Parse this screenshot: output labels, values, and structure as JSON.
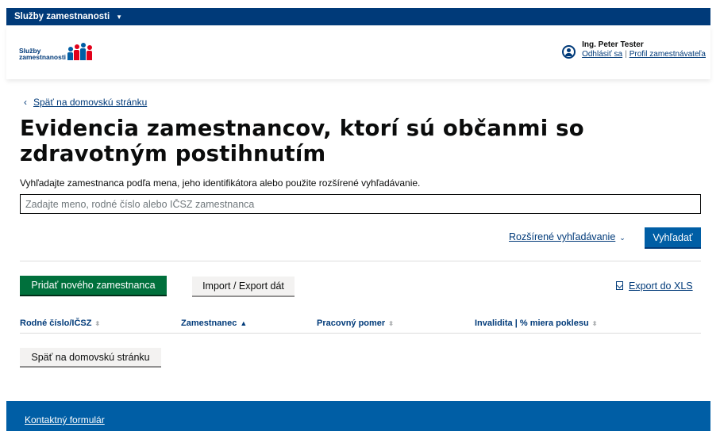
{
  "topbar": {
    "title": "Služby zamestnanosti"
  },
  "header": {
    "logo_text_1": "Služby",
    "logo_text_2": "zamestnanosti",
    "user_name": "Ing. Peter Tester",
    "logout_label": "Odhlásiť sa",
    "profile_label": "Profil zamestnávateľa"
  },
  "main": {
    "back_link": "Späť na domovskú stránku",
    "title": "Evidencia zamestnancov, ktorí sú občanmi so zdravotným postihnutím",
    "description": "Vyhľadajte zamestnanca podľa mena, jeho identifikátora alebo použite rozšírené vyhľadávanie.",
    "search_placeholder": "Zadajte meno, rodné číslo alebo IČSZ zamestnanca",
    "advanced_search_label": "Rozšírené vyhľadávanie",
    "search_button": "Vyhľadať",
    "add_button": "Pridať nového zamestnanca",
    "import_export_button": "Import / Export dát",
    "export_xls_label": "Export do XLS",
    "table": {
      "columns": [
        {
          "label": "Rodné číslo/IČSZ",
          "sort": "none"
        },
        {
          "label": "Zamestnanec",
          "sort": "asc"
        },
        {
          "label": "Pracovný pomer",
          "sort": "none"
        },
        {
          "label": "Invalidita | % miera poklesu",
          "sort": "none"
        }
      ]
    },
    "back_button": "Späť na domovskú stránku"
  },
  "footer": {
    "contact_link": "Kontaktný formulár"
  },
  "colors": {
    "brand_navy": "#003a79",
    "primary_blue": "#005ea5",
    "green": "#00703c",
    "logo_red": "#e2001a"
  }
}
